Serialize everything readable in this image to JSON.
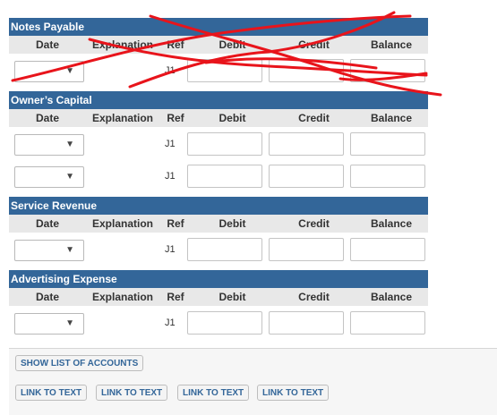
{
  "columns": {
    "date": "Date",
    "explanation": "Explanation",
    "ref": "Ref",
    "debit": "Debit",
    "credit": "Credit",
    "balance": "Balance"
  },
  "accounts": [
    {
      "name": "Notes Payable",
      "rows": [
        {
          "ref": "J1"
        }
      ]
    },
    {
      "name": "Owner’s Capital",
      "rows": [
        {
          "ref": "J1"
        },
        {
          "ref": "J1"
        }
      ]
    },
    {
      "name": "Service Revenue",
      "rows": [
        {
          "ref": "J1"
        }
      ]
    },
    {
      "name": "Advertising Expense",
      "rows": [
        {
          "ref": "J1"
        }
      ]
    }
  ],
  "buttons": {
    "show_accounts": "SHOW LIST OF ACCOUNTS",
    "link_to_text": [
      "LINK TO TEXT",
      "LINK TO TEXT",
      "LINK TO TEXT",
      "LINK TO TEXT"
    ]
  },
  "dropdown_arrow": "▼",
  "annotation_color": "#e8141b"
}
